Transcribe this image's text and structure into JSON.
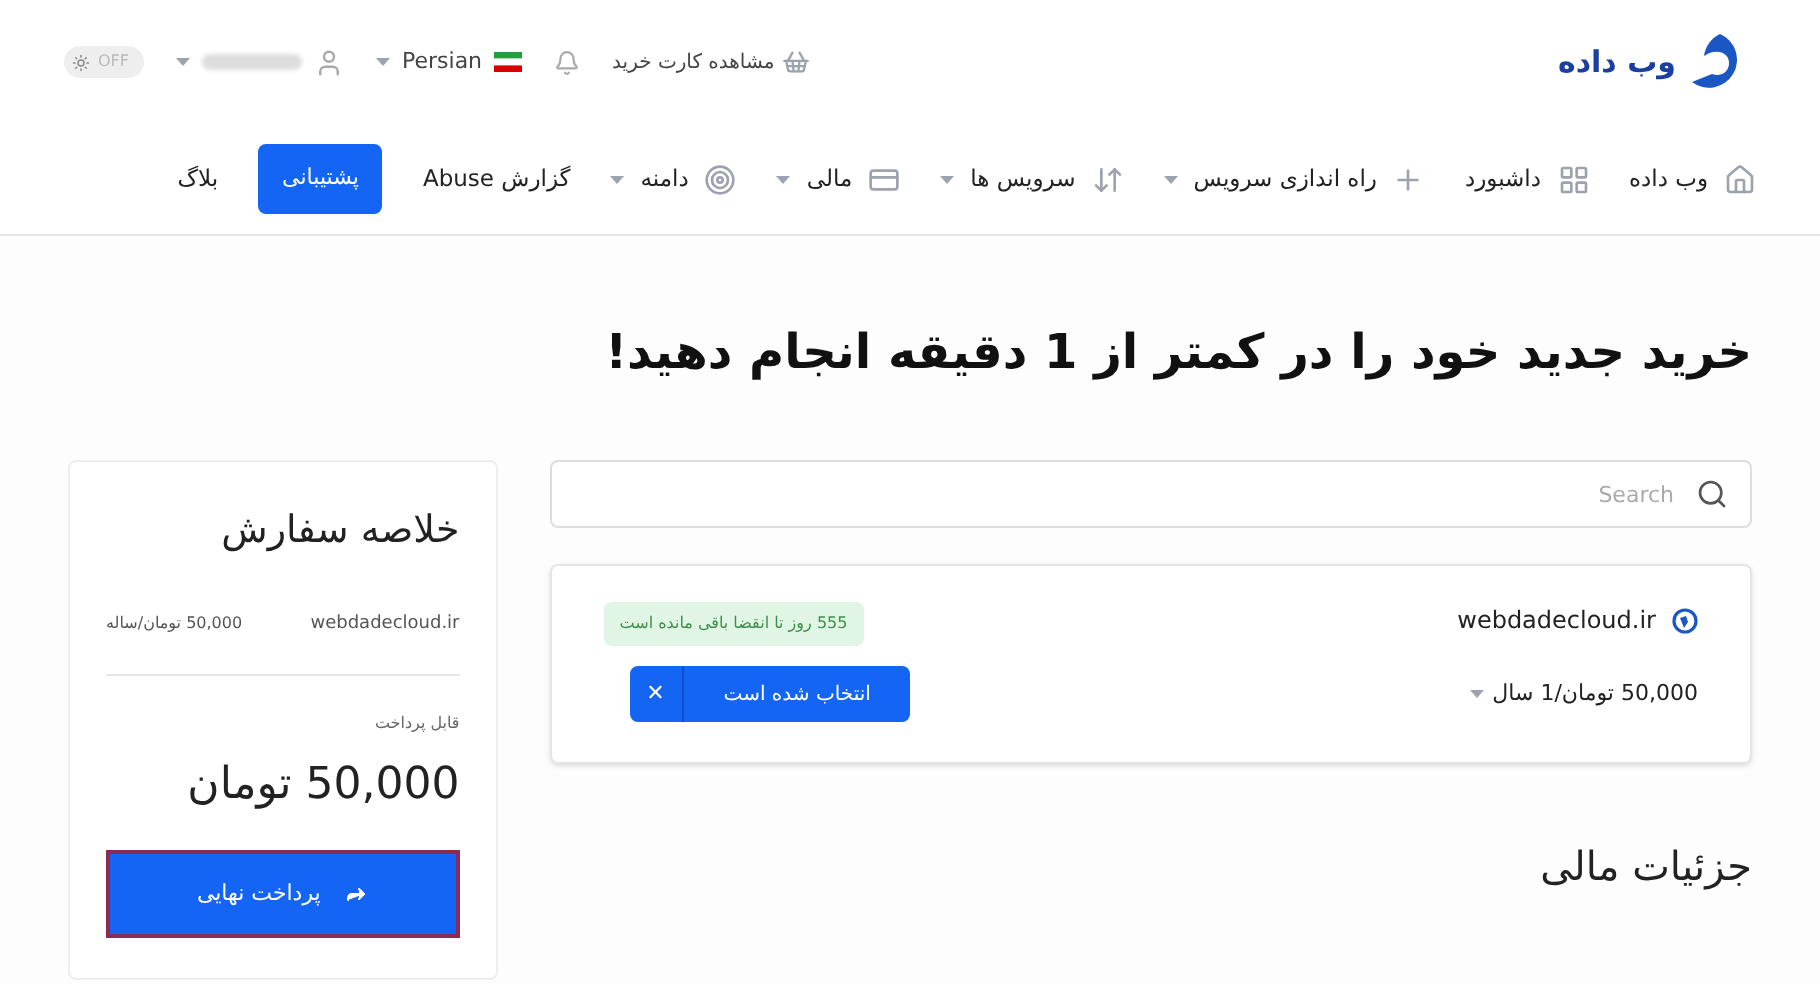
{
  "logo": {
    "text": "وب داده"
  },
  "topbar": {
    "cart_label": "مشاهده کارت خرید",
    "language": "Persian",
    "theme_toggle": {
      "label": "OFF",
      "on": false
    }
  },
  "nav": [
    {
      "label": "وب داده",
      "dropdown": false,
      "kind": "link"
    },
    {
      "label": "داشبورد",
      "dropdown": false,
      "kind": "link"
    },
    {
      "label": "راه اندازی سرویس",
      "dropdown": true,
      "kind": "link"
    },
    {
      "label": "سرویس ها",
      "dropdown": true,
      "kind": "link"
    },
    {
      "label": "مالی",
      "dropdown": true,
      "kind": "link"
    },
    {
      "label": "دامنه",
      "dropdown": true,
      "kind": "link"
    },
    {
      "label": "گزارش Abuse",
      "dropdown": false,
      "kind": "link"
    },
    {
      "label": "پشتیبانی",
      "kind": "button"
    },
    {
      "label": "بلاگ",
      "dropdown": false,
      "kind": "link"
    }
  ],
  "heading": "خرید جدید خود را در کمتر از 1 دقیقه انجام دهید!",
  "search": {
    "placeholder": "Search"
  },
  "domain_card": {
    "domain": "webdadecloud.ir",
    "badge": "555 روز تا انقضا باقی مانده است",
    "price": "50,000 تومان/1 سال",
    "selected_button": "انتخاب شده است",
    "close": "✕"
  },
  "financial_heading": "جزئیات مالی",
  "summary": {
    "title": "خلاصه سفارش",
    "item_name": "webdadecloud.ir",
    "item_price": "50,000 تومان/ساله",
    "payable_label": "قابل پرداخت",
    "total": "50,000 تومان",
    "pay_button": "پرداخت نهایی"
  }
}
